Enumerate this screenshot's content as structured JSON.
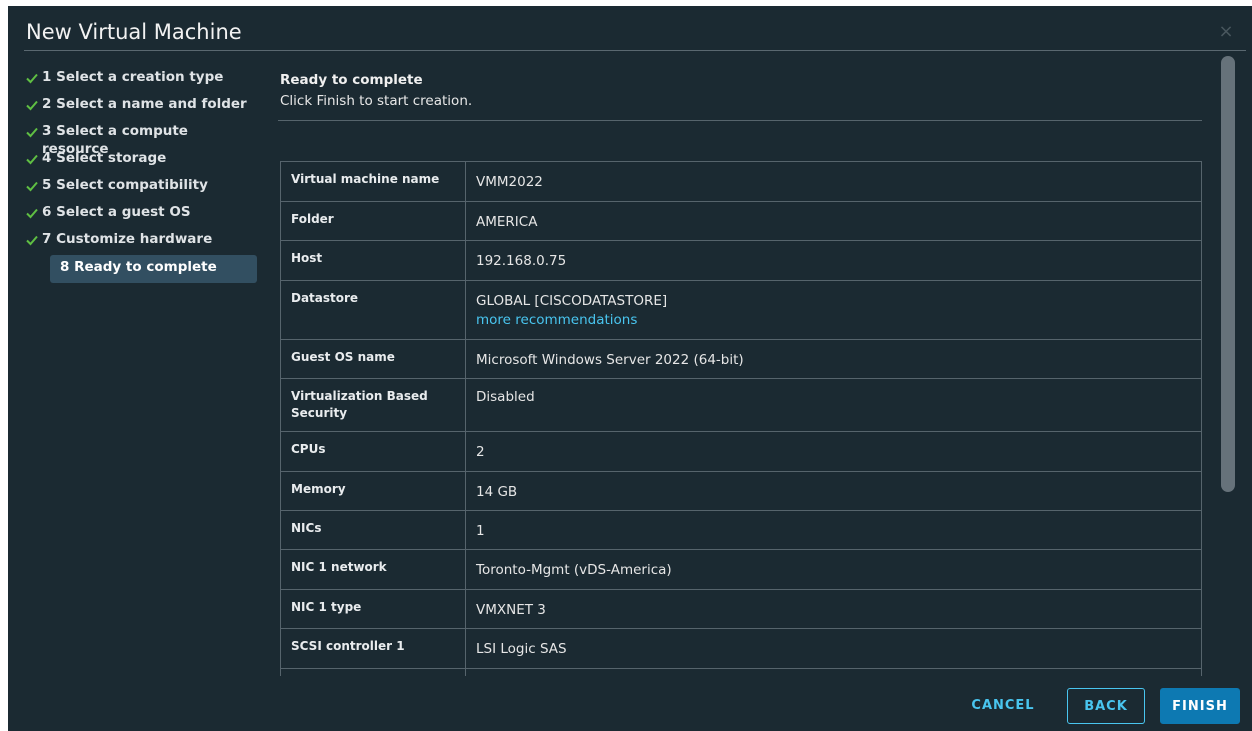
{
  "dialog": {
    "title": "New Virtual Machine",
    "close_symbol": "×"
  },
  "steps": [
    {
      "label": "1 Select a creation type",
      "done": true
    },
    {
      "label": "2 Select a name and folder",
      "done": true
    },
    {
      "label": "3 Select a compute resource",
      "done": true
    },
    {
      "label": "4 Select storage",
      "done": true
    },
    {
      "label": "5 Select compatibility",
      "done": true
    },
    {
      "label": "6 Select a guest OS",
      "done": true
    },
    {
      "label": "7 Customize hardware",
      "done": true
    },
    {
      "label": "8 Ready to complete",
      "done": false,
      "current": true
    }
  ],
  "content": {
    "heading": "Ready to complete",
    "subheading": "Click Finish to start creation."
  },
  "summary": {
    "rows": [
      {
        "key": "Virtual machine name",
        "value": "VMM2022"
      },
      {
        "key": "Folder",
        "value": "AMERICA"
      },
      {
        "key": "Host",
        "value": "192.168.0.75"
      },
      {
        "key": "Datastore",
        "value": "GLOBAL [CISCODATASTORE]",
        "link": "more recommendations"
      },
      {
        "key": "Guest OS name",
        "value": "Microsoft Windows Server 2022 (64-bit)"
      },
      {
        "key": "Virtualization Based Security",
        "value": "Disabled"
      },
      {
        "key": "CPUs",
        "value": "2"
      },
      {
        "key": "Memory",
        "value": "14 GB"
      },
      {
        "key": "NICs",
        "value": "1"
      },
      {
        "key": "NIC 1 network",
        "value": "Toronto-Mgmt (vDS-America)"
      },
      {
        "key": "NIC 1 type",
        "value": "VMXNET 3"
      },
      {
        "key": "SCSI controller 1",
        "value": "LSI Logic SAS"
      }
    ]
  },
  "footer": {
    "cancel_label": "CANCEL",
    "back_label": "BACK",
    "finish_label": "FINISH"
  },
  "colors": {
    "background": "#1b2a32",
    "accent": "#49c5ef",
    "primary_button": "#0d79b2",
    "check": "#5fbf43",
    "current_step_bg": "#324f61"
  },
  "icons": {
    "close": "close-icon",
    "step_done": "checkmark-icon"
  }
}
